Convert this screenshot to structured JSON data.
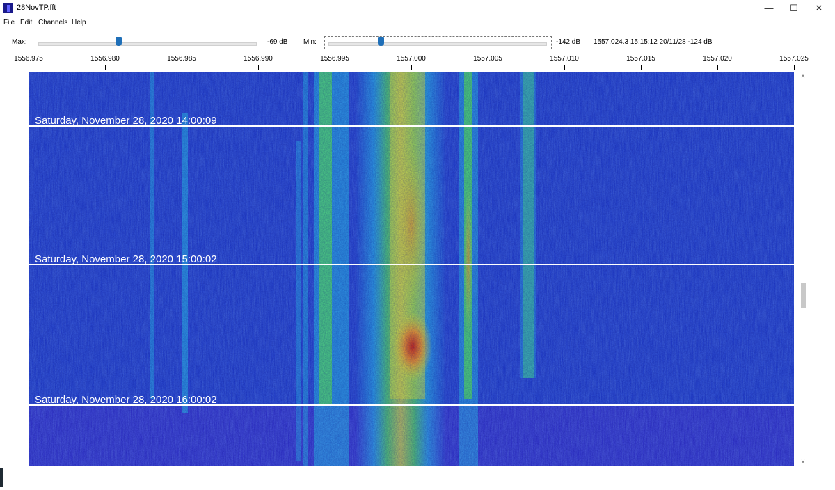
{
  "window": {
    "title": "28NovTP.fft",
    "minimize_glyph": "—",
    "maximize_glyph": "☐",
    "close_glyph": "✕"
  },
  "menu": {
    "items": [
      "File",
      "Edit",
      "Channels",
      "Help"
    ]
  },
  "toolbar": {
    "max_label": "Max:",
    "max_value": "-69 dB",
    "max_level_fraction": 0.37,
    "min_label": "Min:",
    "min_value": "-142 dB",
    "min_level_fraction": 0.24,
    "cursor_readout": "1557.024.3 15:15:12 20/11/28 -124 dB"
  },
  "axis": {
    "ticks": [
      "1556.975",
      "1556.980",
      "1556.985",
      "1556.990",
      "1556.995",
      "1557.000",
      "1557.005",
      "1557.010",
      "1557.015",
      "1557.020",
      "1557.025"
    ]
  },
  "waterfall": {
    "markers": [
      "Saturday, November 28, 2020 14:00:09",
      "Saturday, November 28, 2020 15:00:02",
      "Saturday, November 28, 2020 16:00:02"
    ],
    "colors": {
      "background": "#1f3ecf",
      "cyan": "#2fd0f0",
      "green": "#5ef05a",
      "yellow": "#e8f03a",
      "orange": "#f0a030",
      "red": "#d03018"
    }
  },
  "scrollbar": {
    "up_glyph": "˄",
    "down_glyph": "˅"
  }
}
